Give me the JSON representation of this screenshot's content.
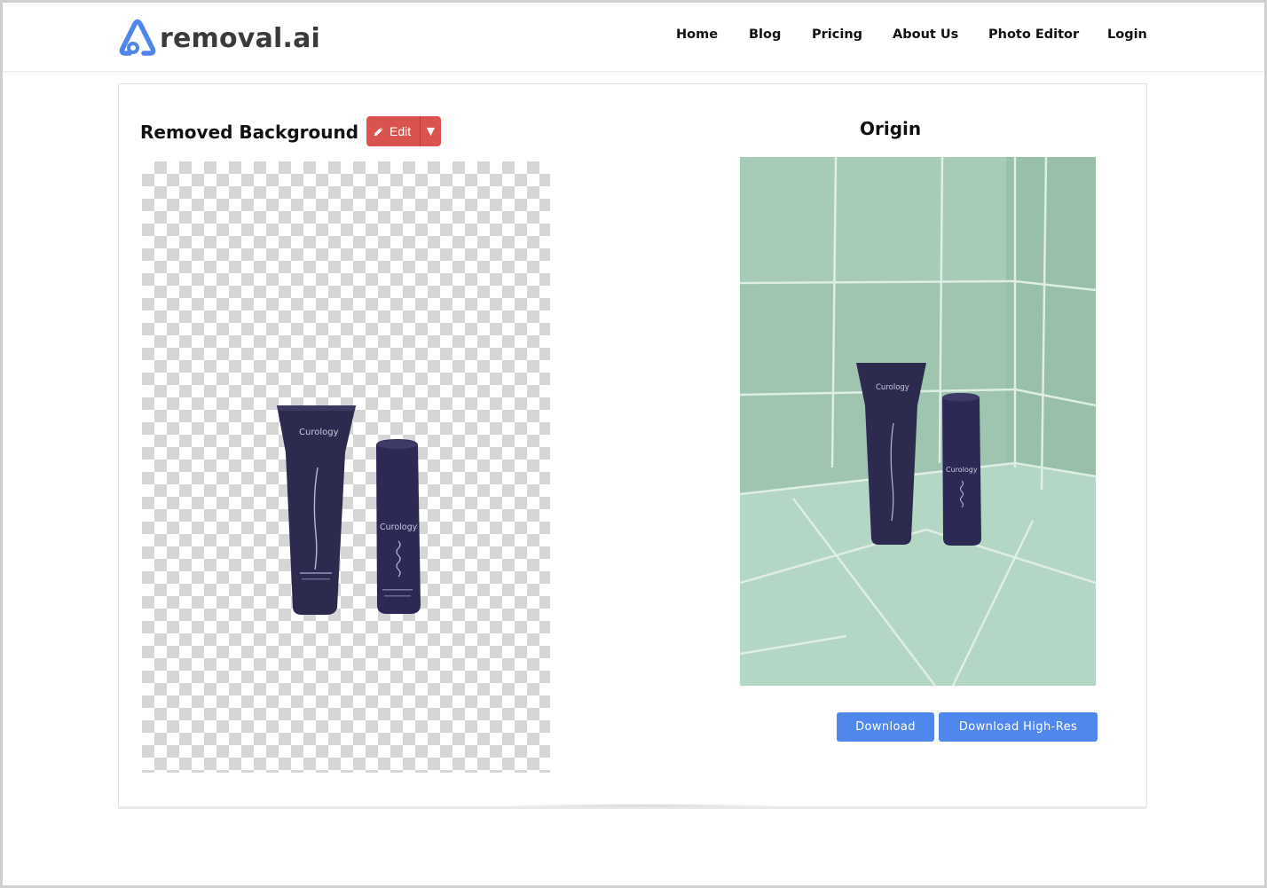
{
  "brand": {
    "name": "removal.ai",
    "accent_color": "#4f86ec"
  },
  "nav": {
    "items": [
      {
        "label": "Home"
      },
      {
        "label": "Blog"
      },
      {
        "label": "Pricing"
      },
      {
        "label": "About Us"
      },
      {
        "label": "Photo Editor"
      },
      {
        "label": "Login"
      }
    ]
  },
  "result": {
    "removed_title": "Removed Background",
    "edit_label": "Edit",
    "edit_color": "#d9534f",
    "origin_title": "Origin",
    "product_brand_text": "Curology",
    "download_label": "Download",
    "download_hires_label": "Download High-Res",
    "download_color": "#5087ec"
  },
  "icons": {
    "edit": "pencil-icon",
    "dropdown": "caret-down-icon",
    "logo": "removal-ai-logo-icon"
  }
}
